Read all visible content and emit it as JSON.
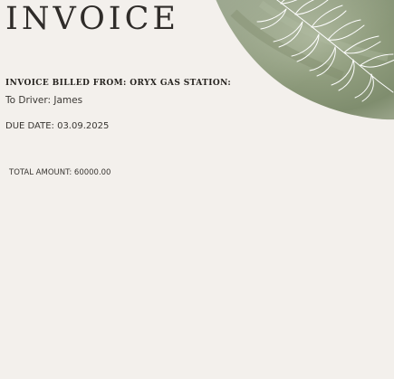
{
  "invoice": {
    "title": "INVOICE",
    "billed_from": "INVOICE BILLED FROM: ORYX GAS STATION:",
    "to_driver": "To Driver: James",
    "due_date": "DUE DATE: 03.09.2025",
    "total_amount": "TOTAL AMOUNT: 60000.00"
  },
  "colors": {
    "background": "#f3f0ec",
    "text": "#2b2926",
    "leaf_green": "#8e9c7c",
    "leaf_lines": "#ffffff"
  },
  "decoration": {
    "icon": "watercolor-leaf-branch-icon"
  }
}
